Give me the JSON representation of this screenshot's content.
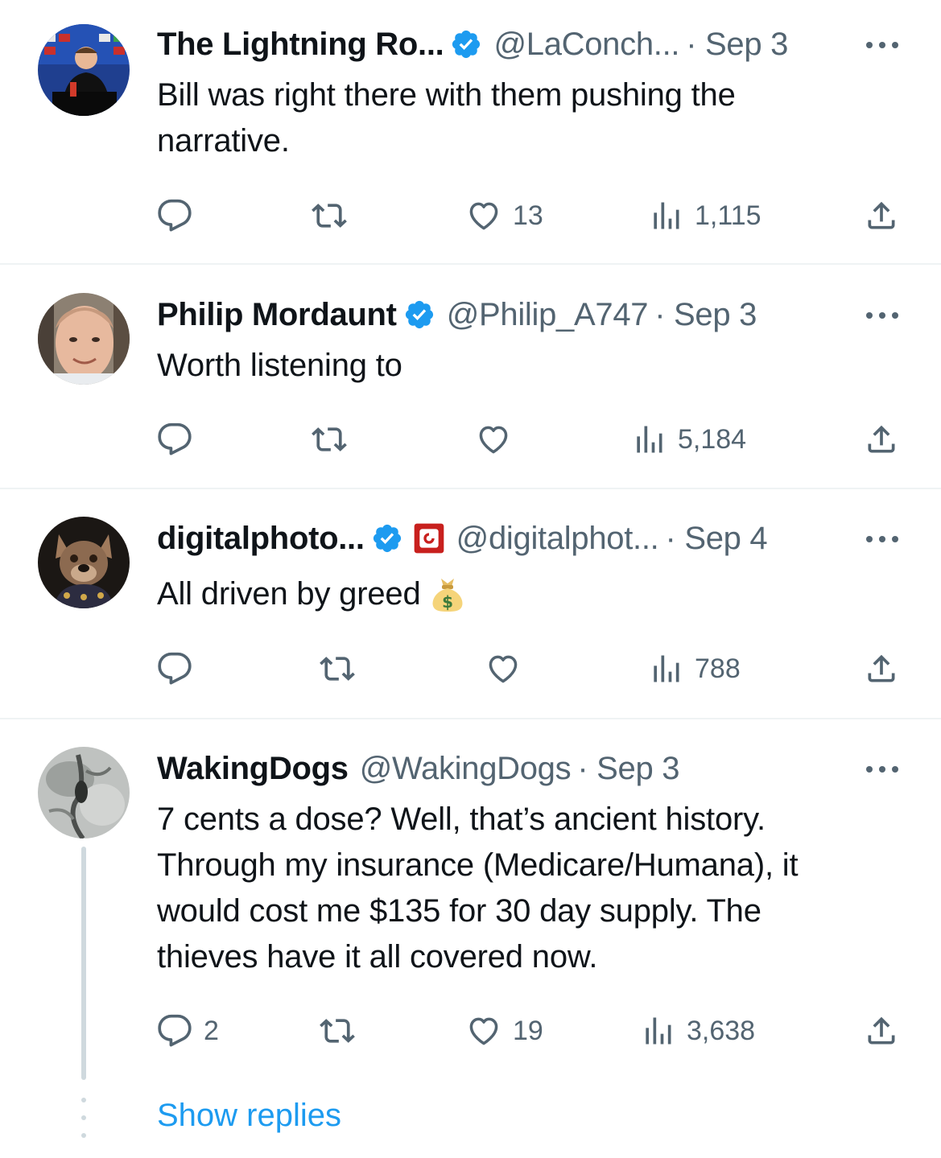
{
  "tweets": [
    {
      "name": "The Lightning Ro...",
      "handle": "@LaConch...",
      "date": "· Sep 3",
      "verified": true,
      "lines": [
        "Bill was right there with them pushing the",
        "narrative."
      ],
      "replies": "",
      "reposts": "",
      "likes": "13",
      "views": "1,115"
    },
    {
      "name": "Philip Mordaunt",
      "handle": "@Philip_A747",
      "date": "· Sep 3",
      "verified": true,
      "lines": [
        "Worth listening to"
      ],
      "replies": "",
      "reposts": "",
      "likes": "",
      "views": "5,184"
    },
    {
      "name": "digitalphoto...",
      "handle": "@digitalphot...",
      "date": "· Sep 4",
      "verified": true,
      "affiliate_badge": true,
      "lines": [
        "All driven by greed"
      ],
      "emoji": "money-bag",
      "replies": "",
      "reposts": "",
      "likes": "",
      "views": "788"
    },
    {
      "name": "WakingDogs",
      "handle": "@WakingDogs",
      "date": "· Sep 3",
      "verified": false,
      "lines": [
        "7 cents a dose? Well, that’s ancient history.",
        "Through my insurance (Medicare/Humana), it",
        "would cost me $135 for 30 day supply. The",
        "thieves have it all covered now."
      ],
      "replies": "2",
      "reposts": "",
      "likes": "19",
      "views": "3,638"
    }
  ],
  "show_replies": "Show replies",
  "colors": {
    "text": "#0f1419",
    "secondary": "#536471",
    "accent": "#1d9bf0",
    "divider": "#eff3f4",
    "thread_line": "#cfd9de"
  },
  "icons": {
    "reply": "speech-bubble-icon",
    "repost": "repost-arrows-icon",
    "like": "heart-icon",
    "views": "bar-chart-icon",
    "share": "share-upload-icon",
    "more": "ellipsis-icon",
    "verified": "verified-badge-icon"
  }
}
